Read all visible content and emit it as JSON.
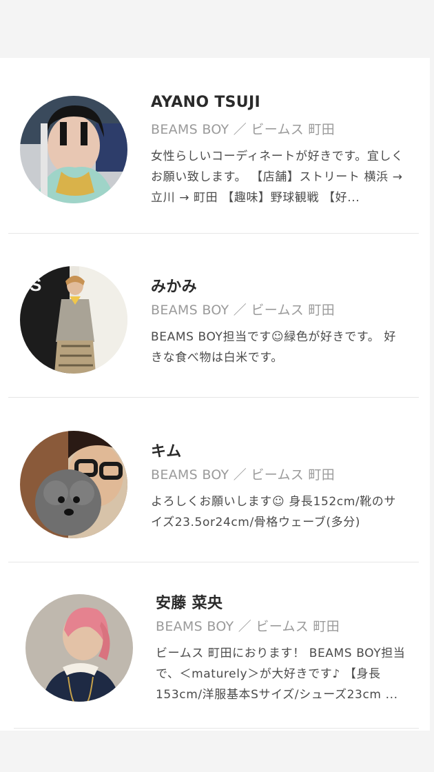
{
  "staff": [
    {
      "name": "AYANO TSUJI",
      "shop": "BEAMS BOY ／ ビームス 町田",
      "bio": "女性らしいコーディネートが好きです。宜しくお願い致します。 【店舗】ストリート 横浜 → 立川 → 町田 【趣味】野球観戦 【好..."
    },
    {
      "name": "みかみ",
      "shop": "BEAMS BOY ／ ビームス 町田",
      "bio": "BEAMS BOY担当です☺緑色が好きです。 好きな食べ物は白米です。"
    },
    {
      "name": "キム",
      "shop": "BEAMS BOY ／ ビームス 町田",
      "bio": "よろしくお願いします☺ 身長152cm/靴のサイズ23.5or24cm/骨格ウェーブ(多分)"
    },
    {
      "name": "安藤 菜央",
      "shop": "BEAMS BOY ／ ビームス 町田",
      "bio": "ビームス 町田におります！ BEAMS BOY担当で、＜maturely＞が大好きです♪ 【身長153cm/洋服基本Sサイズ/シューズ23cm ..."
    }
  ]
}
